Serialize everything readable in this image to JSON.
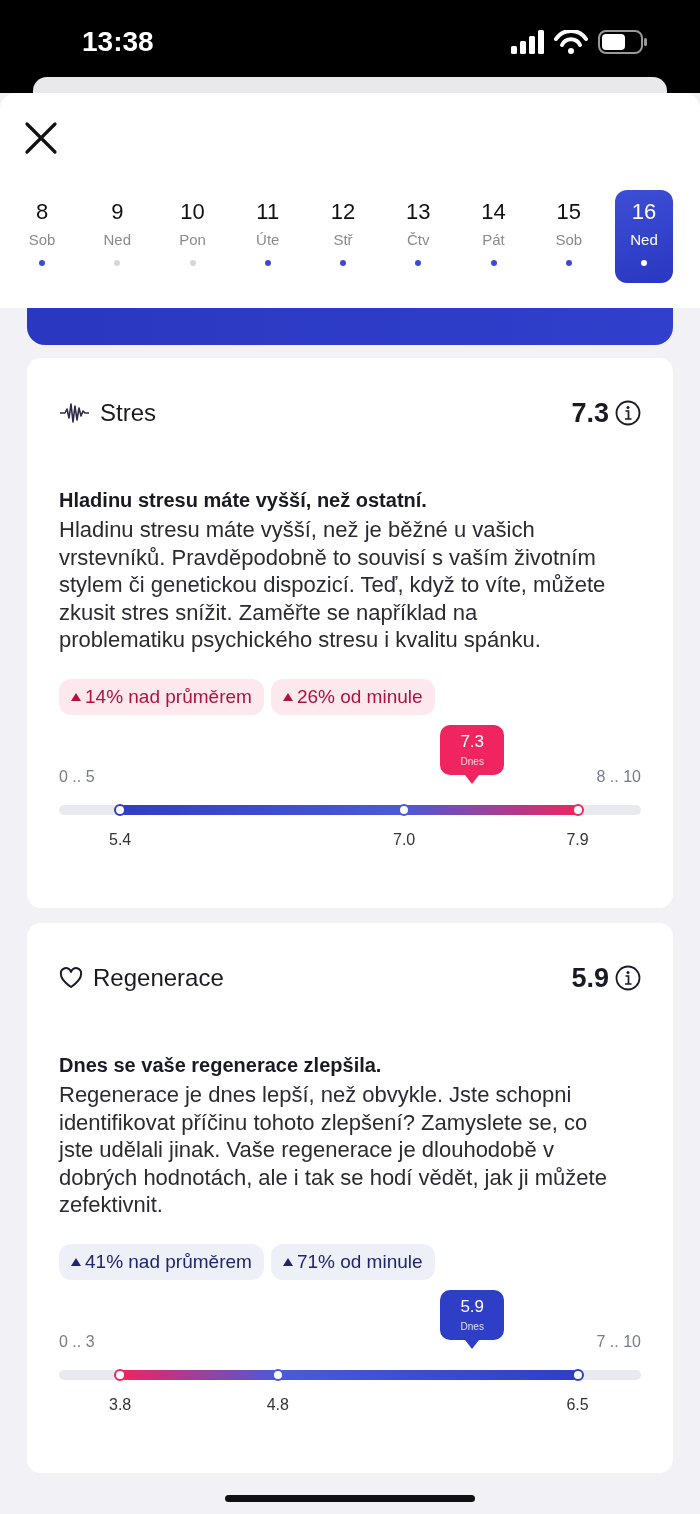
{
  "status_bar": {
    "time": "13:38"
  },
  "days": [
    {
      "day": "8",
      "weekday": "Sob",
      "has_data": true,
      "selected": false
    },
    {
      "day": "9",
      "weekday": "Ned",
      "has_data": false,
      "selected": false
    },
    {
      "day": "10",
      "weekday": "Pon",
      "has_data": false,
      "selected": false
    },
    {
      "day": "11",
      "weekday": "Úte",
      "has_data": true,
      "selected": false
    },
    {
      "day": "12",
      "weekday": "Stř",
      "has_data": true,
      "selected": false
    },
    {
      "day": "13",
      "weekday": "Čtv",
      "has_data": true,
      "selected": false
    },
    {
      "day": "14",
      "weekday": "Pát",
      "has_data": true,
      "selected": false
    },
    {
      "day": "15",
      "weekday": "Sob",
      "has_data": true,
      "selected": false
    },
    {
      "day": "16",
      "weekday": "Ned",
      "has_data": true,
      "selected": true
    }
  ],
  "cards": [
    {
      "kind": "stress",
      "title": "Stres",
      "score": "7.3",
      "headline": "Hladinu stresu máte vyšší, než ostatní.",
      "text": "Hladinu stresu máte vyšší, než je běžné u vašich vrstevníků. Pravděpodobně to souvisí s vaším životním stylem či genetickou dispozicí. Teď, když to víte, můžete zkusit stres snížit. Zaměřte se například na problematiku psychického stresu i kvalitu spánku.",
      "badges": [
        {
          "kind": "bad",
          "text": "14% nad průměrem"
        },
        {
          "kind": "bad",
          "text": "26% od minule"
        }
      ],
      "range": {
        "low": "0 .. 5",
        "high": "8 .. 10",
        "marker": {
          "value": "7.3",
          "caption": "Dnes",
          "color": "#f0245e"
        },
        "points": [
          {
            "label": "5.4",
            "level": 0.105,
            "color": "#2f3ec6"
          },
          {
            "label": "7.0",
            "level": 0.593,
            "color": "#4a5ad8"
          },
          {
            "label": "7.9",
            "level": 0.891,
            "color": "#f0245e"
          }
        ]
      }
    },
    {
      "kind": "regeneration",
      "title": "Regenerace",
      "score": "5.9",
      "headline": "Dnes se vaše regenerace zlepšila.",
      "text": "Regenerace je dnes lepší, než obvykle. Jste schopni identifikovat příčinu tohoto zlepšení? Zamyslete se, co jste udělali jinak. Vaše regenerace je dlouhodobě v dobrých hodnotách, ale i tak se hodí vědět, jak ji můžete zefektivnit.",
      "badges": [
        {
          "kind": "good",
          "text": "41% nad průměrem"
        },
        {
          "kind": "good",
          "text": "71% od minule"
        }
      ],
      "range": {
        "low": "0 .. 3",
        "high": "7 .. 10",
        "marker": {
          "value": "5.9",
          "caption": "Dnes",
          "color": "#2f3ec6"
        },
        "points": [
          {
            "label": "3.8",
            "level": 0.105,
            "color": "#f0245e"
          },
          {
            "label": "4.8",
            "level": 0.376,
            "color": "#4a5ad8"
          },
          {
            "label": "6.5",
            "level": 0.891,
            "color": "#2f3ec6"
          }
        ]
      }
    }
  ]
}
